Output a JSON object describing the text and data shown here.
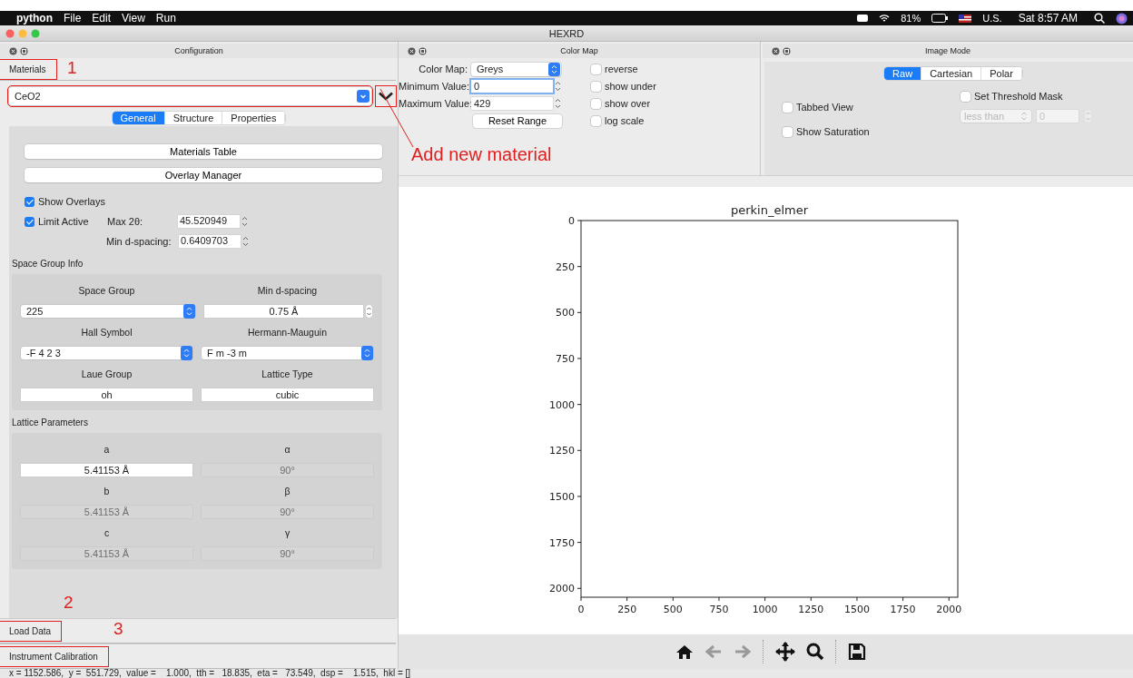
{
  "menubar": {
    "app": "python",
    "menus": [
      "File",
      "Edit",
      "View",
      "Run"
    ],
    "battery": "81%",
    "input_source": "U.S.",
    "clock": "Sat 8:57 AM"
  },
  "window": {
    "title": "HEXRD"
  },
  "configuration": {
    "title": "Configuration",
    "materials_section": {
      "label": "Materials",
      "highlighted": true,
      "annotation": "1"
    },
    "material": {
      "value": "CeO2",
      "highlighted": true
    },
    "add_material": {
      "highlighted": true,
      "note": "Add new material"
    },
    "tabs": [
      {
        "label": "General",
        "selected": true
      },
      {
        "label": "Structure",
        "selected": false
      },
      {
        "label": "Properties",
        "selected": false
      }
    ],
    "buttons": [
      "Materials Table",
      "Overlay Manager"
    ],
    "show_overlays": {
      "label": "Show Overlays",
      "checked": true
    },
    "limit_active": {
      "label": "Limit Active",
      "checked": true
    },
    "max_2theta": {
      "label": "Max 2θ:",
      "value": "45.520949"
    },
    "min_d_spacing": {
      "label": "Min d-spacing:",
      "value": "0.6409703"
    },
    "space_group_info": {
      "title": "Space Group Info",
      "fields": [
        {
          "label": "Space Group",
          "value": "225",
          "kind": "combo"
        },
        {
          "label": "Min d-spacing",
          "value": "0.75 Å",
          "kind": "spin"
        },
        {
          "label": "Hall Symbol",
          "value": "-F 4 2 3",
          "kind": "combo"
        },
        {
          "label": "Hermann-Mauguin",
          "value": "F m -3 m",
          "kind": "combo"
        },
        {
          "label": "Laue Group",
          "value": "oh",
          "kind": "text"
        },
        {
          "label": "Lattice Type",
          "value": "cubic",
          "kind": "text"
        }
      ]
    },
    "lattice_parameters": {
      "title": "Lattice Parameters",
      "params": [
        {
          "label": "a",
          "value": "5.41153 Å",
          "disabled": false
        },
        {
          "label": "α",
          "value": "90°",
          "disabled": true
        },
        {
          "label": "b",
          "value": "5.41153 Å",
          "disabled": true
        },
        {
          "label": "β",
          "value": "90°",
          "disabled": true
        },
        {
          "label": "c",
          "value": "5.41153 Å",
          "disabled": true
        },
        {
          "label": "γ",
          "value": "90°",
          "disabled": true
        }
      ]
    },
    "bottom_sections": [
      {
        "label": "Load Data",
        "highlighted": true,
        "annotation": "2"
      },
      {
        "label": "Instrument Calibration",
        "highlighted": true,
        "annotation": "3"
      }
    ]
  },
  "color_map": {
    "title": "Color Map",
    "colormap": {
      "label": "Color Map:",
      "value": "Greys"
    },
    "minimum": {
      "label": "Minimum Value:",
      "value": "0",
      "focused": true
    },
    "maximum": {
      "label": "Maximum Value:",
      "value": "429",
      "focused": false
    },
    "reset": "Reset Range",
    "options": [
      {
        "label": "reverse",
        "checked": false
      },
      {
        "label": "show under",
        "checked": false
      },
      {
        "label": "show over",
        "checked": false
      },
      {
        "label": "log scale",
        "checked": false
      }
    ]
  },
  "image_mode": {
    "title": "Image Mode",
    "tabs": [
      {
        "label": "Raw",
        "selected": true
      },
      {
        "label": "Cartesian",
        "selected": false
      },
      {
        "label": "Polar",
        "selected": false
      }
    ],
    "options": [
      {
        "label": "Tabbed View",
        "checked": false
      },
      {
        "label": "Show Saturation",
        "checked": false
      }
    ],
    "threshold": {
      "label": "Set Threshold Mask",
      "checked": false,
      "comparison": "less than",
      "value": "0",
      "disabled": true
    }
  },
  "plot": {
    "chart_data": {
      "type": "scatter",
      "title": "perkin_elmer",
      "xlim": [
        0,
        2048
      ],
      "ylim": [
        2048,
        0
      ],
      "xticks": [
        0,
        250,
        500,
        750,
        1000,
        1250,
        1500,
        1750,
        2000
      ],
      "yticks": [
        0,
        250,
        500,
        750,
        1000,
        1250,
        1500,
        1750,
        2000
      ]
    }
  },
  "status_bar": "x = 1152.586,  y =  551.729,  value =    1.000,  tth =   18.835,  eta =   73.549,  dsp =    1.515,  hkl = []"
}
